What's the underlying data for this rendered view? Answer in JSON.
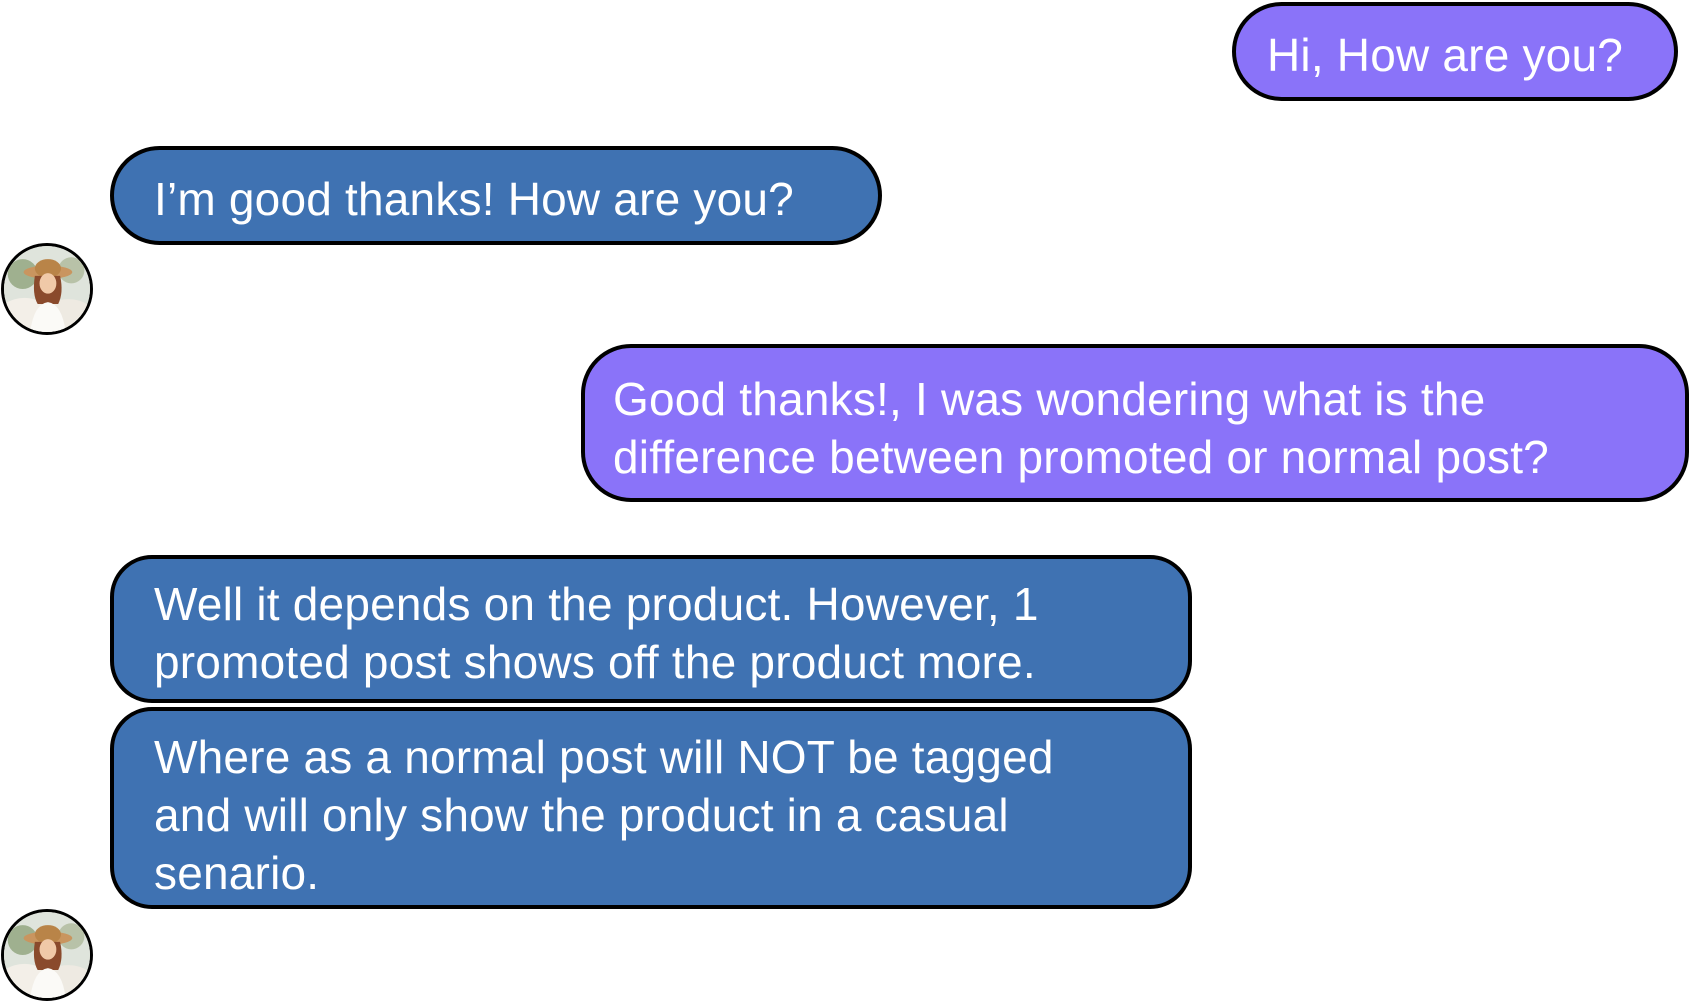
{
  "conversation": {
    "messages": [
      {
        "sender": "self",
        "text": "Hi, How are you?"
      },
      {
        "sender": "contact",
        "text": "I’m good thanks! How are you?"
      },
      {
        "sender": "self",
        "text": "Good thanks!, I was wondering what is the\ndifference between promoted or normal post?"
      },
      {
        "sender": "contact",
        "text": "Well it depends on the product. However, 1\npromoted post shows off the product more."
      },
      {
        "sender": "contact",
        "text": "Where as a normal post will NOT be tagged\nand will only show the product in a casual\nsenario."
      }
    ]
  },
  "colors": {
    "outgoing_bubble": "#8a73f9",
    "incoming_bubble": "#3f72b2",
    "bubble_border": "#000000",
    "bubble_text": "#ffffff"
  },
  "icons": {
    "contact_avatar": "avatar-photo-woman-in-hat"
  }
}
